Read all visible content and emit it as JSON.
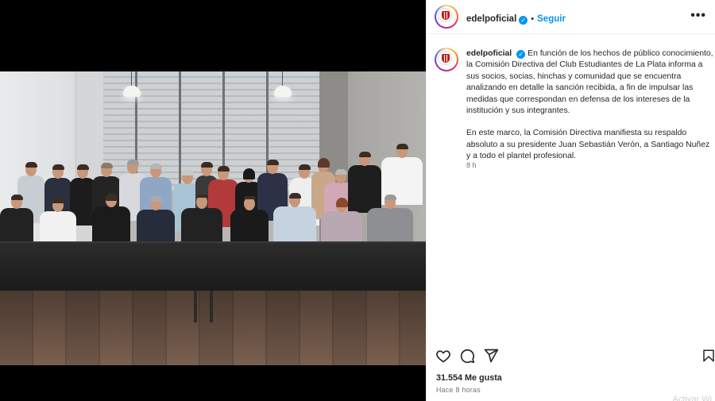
{
  "post": {
    "username": "edelpoficial",
    "follow_label": "Seguir",
    "separator": "•",
    "verified_glyph": "✓",
    "more_icon": "•••",
    "caption_paragraph_1": "En función de los hechos de público conocimiento, la Comisión Directiva del Club Estudiantes de La Plata informa a sus socios, socias, hinchas y comunidad que se encuentra analizando en detalle la sanción recibida, a fin de impulsar las medidas que correspondan en defensa de los intereses de la institución y sus integrantes.",
    "caption_paragraph_2": "En este marco, la Comisión Directiva manifiesta su respaldo absoluto a su presidente Juan Sebastián Verón, a Santiago Nuñez y a todo el plantel profesional.",
    "comment_time": "8 h",
    "likes": "31.554 Me gusta",
    "posted_ago": "Hace 8 horas"
  },
  "actions": {
    "like_icon": "heart-icon",
    "comment_icon": "comment-icon",
    "share_icon": "share-icon",
    "save_icon": "bookmark-icon"
  },
  "watermark": "Activar Wi",
  "colors": {
    "accent": "#0095f6",
    "text": "#262626",
    "muted": "#737373",
    "crest_red": "#d6221b"
  }
}
